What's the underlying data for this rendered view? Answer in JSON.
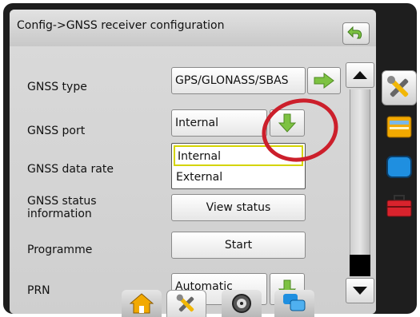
{
  "header": {
    "title": "Config->GNSS receiver configuration",
    "back_icon": "return-arrow-icon"
  },
  "settings": {
    "gnss_type": {
      "label": "GNSS type",
      "value": "GPS/GLONASS/SBAS",
      "action_icon": "arrow-right-icon"
    },
    "gnss_port": {
      "label": "GNSS port",
      "value": "Internal",
      "action_icon": "arrow-down-icon"
    },
    "gnss_data_rate": {
      "label": "GNSS data rate"
    },
    "gnss_status": {
      "label_line1": "GNSS status",
      "label_line2": "information",
      "button": "View status"
    },
    "programme": {
      "label": "Programme",
      "button": "Start"
    },
    "prn": {
      "label": "PRN",
      "value": "Automatic",
      "action_icon": "arrow-down-icon"
    }
  },
  "dropdown": {
    "options": [
      "Internal",
      "External"
    ],
    "selected": "Internal"
  },
  "side_tabs": [
    "tools-icon",
    "folder-icon",
    "display-icon",
    "toolbox-icon"
  ],
  "bottom_tabs": [
    "home-icon",
    "tools-icon",
    "gauge-icon",
    "chat-icon"
  ],
  "colors": {
    "accent_green": "#7dc242",
    "highlight_red": "#cc1f2b",
    "selection_yellow": "#d4d400"
  }
}
